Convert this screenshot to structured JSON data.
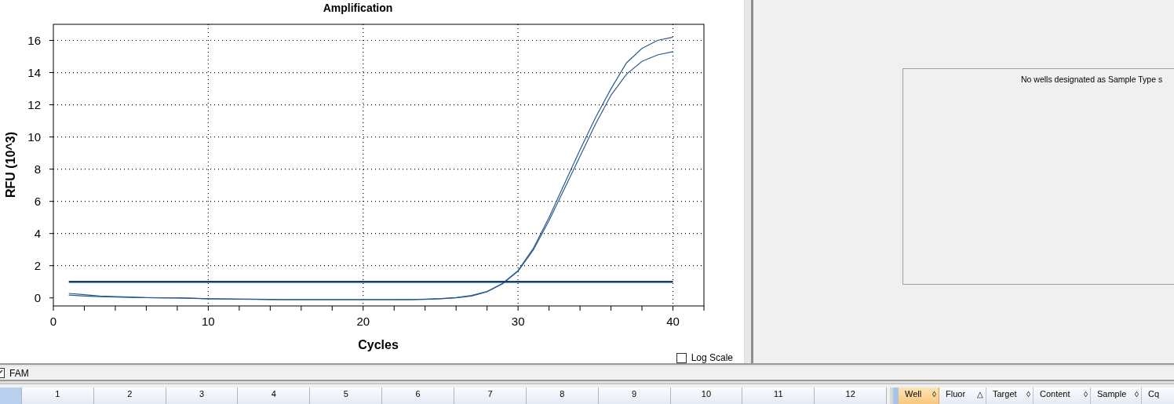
{
  "chart_panel": {
    "title": "Amplification",
    "chart_data": {
      "type": "line",
      "xlabel": "Cycles",
      "ylabel": "RFU (10^3)",
      "x": [
        1,
        2,
        3,
        4,
        5,
        6,
        7,
        8,
        9,
        10,
        11,
        12,
        13,
        14,
        15,
        16,
        17,
        18,
        19,
        20,
        21,
        22,
        23,
        24,
        25,
        26,
        27,
        28,
        29,
        30,
        31,
        32,
        33,
        34,
        35,
        36,
        37,
        38,
        39,
        40
      ],
      "series": [
        {
          "color": "#2b5c8f",
          "values": [
            0.28,
            0.2,
            0.12,
            0.08,
            0.05,
            0.02,
            0,
            0,
            -0.02,
            -0.05,
            -0.06,
            -0.08,
            -0.08,
            -0.09,
            -0.1,
            -0.1,
            -0.1,
            -0.1,
            -0.1,
            -0.1,
            -0.1,
            -0.1,
            -0.1,
            -0.08,
            -0.04,
            0.02,
            0.15,
            0.4,
            0.9,
            1.7,
            3.1,
            5.0,
            7.1,
            9.2,
            11.2,
            13.0,
            14.6,
            15.5,
            16.0,
            16.2
          ]
        },
        {
          "color": "#2b5c8f",
          "values": [
            0.18,
            0.12,
            0.08,
            0.05,
            0.03,
            0.01,
            0,
            -0.01,
            -0.03,
            -0.05,
            -0.07,
            -0.08,
            -0.09,
            -0.1,
            -0.11,
            -0.11,
            -0.11,
            -0.11,
            -0.11,
            -0.11,
            -0.11,
            -0.11,
            -0.1,
            -0.09,
            -0.05,
            0.0,
            0.12,
            0.38,
            0.88,
            1.65,
            3.0,
            4.8,
            6.8,
            8.8,
            10.8,
            12.6,
            13.9,
            14.7,
            15.1,
            15.3
          ]
        },
        {
          "color": "#0d3f73",
          "values": [
            1,
            1,
            1,
            1,
            1,
            1,
            1,
            1,
            1,
            1,
            1,
            1,
            1,
            1,
            1,
            1,
            1,
            1,
            1,
            1,
            1,
            1,
            1,
            1,
            1,
            1,
            1,
            1,
            1,
            1,
            1,
            1,
            1,
            1,
            1,
            1,
            1,
            1,
            1,
            1
          ]
        }
      ],
      "grid": true,
      "xlim": [
        0,
        42
      ],
      "ylim": [
        -0.5,
        17
      ],
      "xticks": [
        0,
        10,
        20,
        30,
        40
      ],
      "yticks": [
        0,
        2,
        4,
        6,
        8,
        10,
        12,
        14,
        16
      ]
    },
    "log_scale": {
      "label": "Log Scale",
      "checked": false
    }
  },
  "message_panel": {
    "message": "No wells designated as Sample Type s"
  },
  "fluorophores": [
    {
      "label": "FAM",
      "checked": true
    }
  ],
  "plate_columns": [
    "1",
    "2",
    "3",
    "4",
    "5",
    "6",
    "7",
    "8",
    "9",
    "10",
    "11",
    "12"
  ],
  "well_table": {
    "columns": [
      {
        "label": "Well",
        "selected": true,
        "sort_glyph": "◊"
      },
      {
        "label": "Fluor",
        "selected": false,
        "sort_glyph": "△"
      },
      {
        "label": "Target",
        "selected": false,
        "sort_glyph": "◊"
      },
      {
        "label": "Content",
        "selected": false,
        "sort_glyph": "◊"
      },
      {
        "label": "Sample",
        "selected": false,
        "sort_glyph": "◊"
      },
      {
        "label": "Cq",
        "selected": false
      }
    ]
  }
}
